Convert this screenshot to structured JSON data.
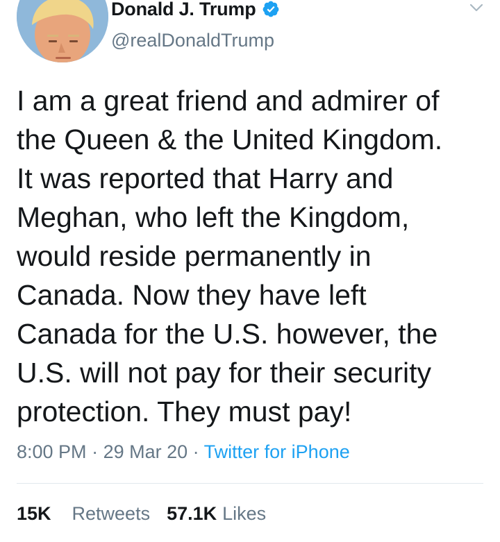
{
  "author": {
    "display_name": "Donald J. Trump",
    "handle": "@realDonaldTrump",
    "verified": true
  },
  "tweet": {
    "text": "I am a great friend and admirer of\nthe Queen & the United Kingdom.\nIt was reported that Harry and\nMeghan, who left the Kingdom,\nwould reside permanently in\nCanada. Now they have left\nCanada for the U.S. however, the\nU.S. will not pay for their security\nprotection. They must pay!",
    "time": "8:00 PM",
    "separator": " · ",
    "date": "29 Mar 20",
    "source": "Twitter for iPhone"
  },
  "stats": {
    "retweets_count": "15K",
    "retweets_label": "Retweets",
    "likes_count": "57.1K",
    "likes_label": "Likes"
  },
  "colors": {
    "text": "#14171a",
    "secondary": "#657786",
    "accent": "#1da1f2",
    "divider": "#e1e8ed"
  },
  "icons": {
    "verified": "verified-badge-icon",
    "menu": "chevron-down-icon"
  }
}
